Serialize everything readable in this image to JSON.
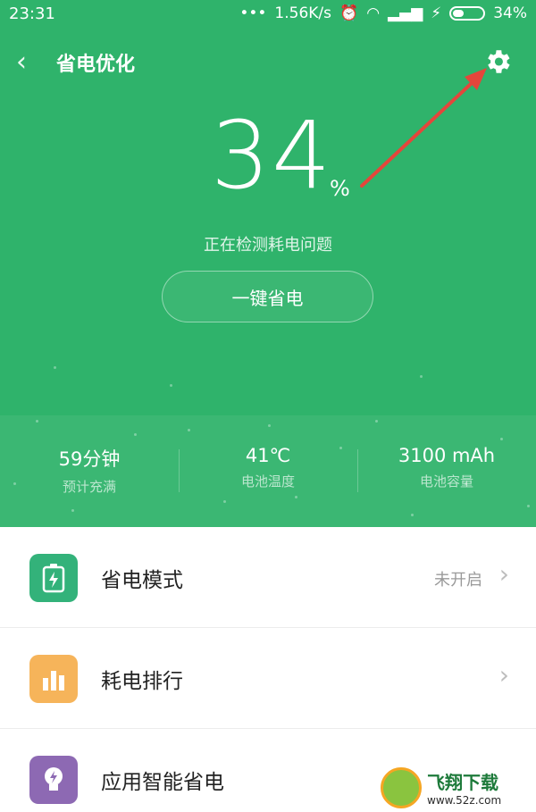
{
  "status_bar": {
    "time": "23:31",
    "network_speed": "1.56K/s",
    "battery": "34%"
  },
  "header": {
    "back_icon": "chevron-left-icon",
    "title": "省电优化",
    "settings_icon": "gear-icon"
  },
  "battery": {
    "percent_value": "34",
    "percent_unit": "%",
    "detect_text": "正在检测耗电问题",
    "one_key_label": "一键省电"
  },
  "stats": [
    {
      "value": "59分钟",
      "label": "预计充满"
    },
    {
      "value": "41℃",
      "label": "电池温度"
    },
    {
      "value": "3100 mAh",
      "label": "电池容量"
    }
  ],
  "list": [
    {
      "label": "省电模式",
      "status": "未开启",
      "icon": "battery-icon",
      "color": "#33b27a"
    },
    {
      "label": "耗电排行",
      "status": "",
      "icon": "bar-chart-icon",
      "color": "#f6b45a"
    },
    {
      "label": "应用智能省电",
      "status": "",
      "icon": "lightbulb-icon",
      "color": "#8d69b3"
    }
  ],
  "watermark": {
    "name": "飞翔下载",
    "url": "www.52z.com"
  },
  "colors": {
    "accent_green": "#2fb36b",
    "arrow_red": "#e4463b"
  }
}
